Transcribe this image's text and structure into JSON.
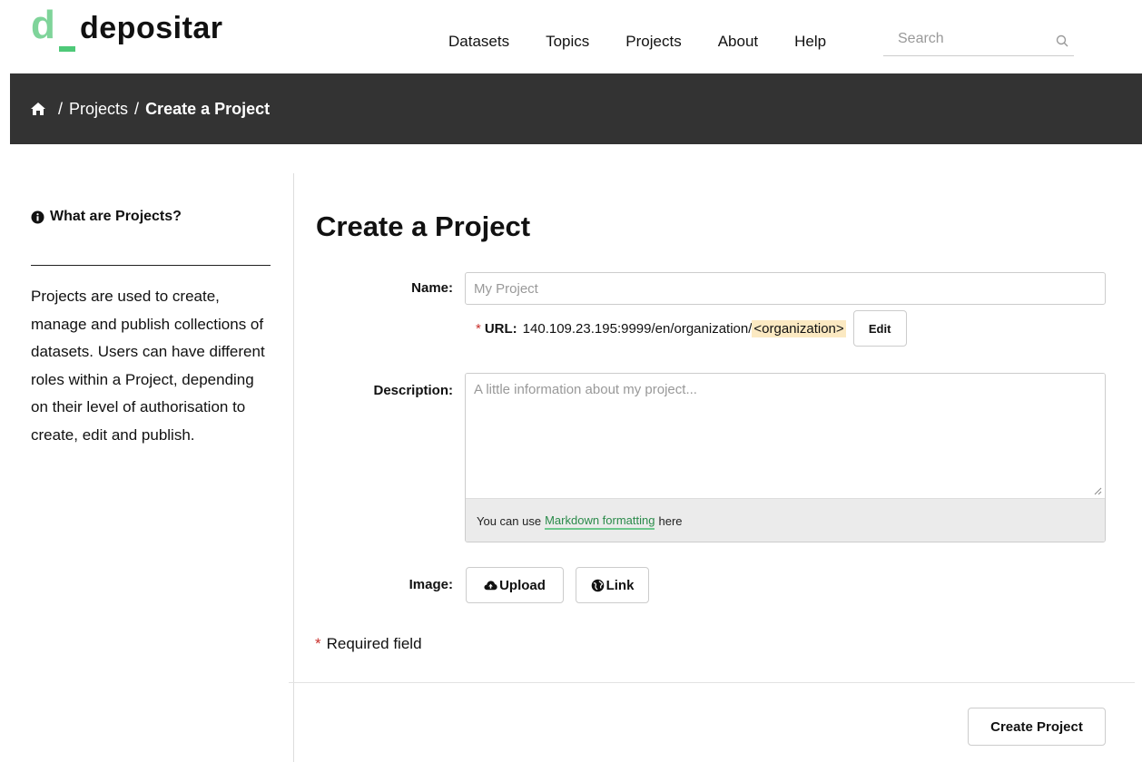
{
  "header": {
    "logo_mark": "d",
    "logo_text": "depositar",
    "nav": [
      "Datasets",
      "Topics",
      "Projects",
      "About",
      "Help"
    ],
    "search_placeholder": "Search"
  },
  "breadcrumb": {
    "separator": "/",
    "items": [
      "Projects",
      "Create a Project"
    ]
  },
  "sidebar": {
    "heading": "What are Projects?",
    "text": "Projects are used to create, manage and publish collections of datasets. Users can have different roles within a Project, depending on their level of authorisation to create, edit and publish."
  },
  "form": {
    "title": "Create a Project",
    "name_label": "Name:",
    "name_placeholder": "My Project",
    "url_star": "*",
    "url_label": "URL:",
    "url_base": "140.109.23.195:9999/en/organization/",
    "url_slug": "<organization>",
    "edit_label": "Edit",
    "description_label": "Description:",
    "description_placeholder": "A little information about my project...",
    "markdown_prefix": "You can use",
    "markdown_link": "Markdown formatting",
    "markdown_suffix": "here",
    "image_label": "Image:",
    "upload_label": "Upload",
    "link_label": "Link",
    "required_star": "*",
    "required_note": "Required field",
    "submit_label": "Create Project"
  },
  "colors": {
    "logo_green": "#7fd49a",
    "breadcrumb_bg": "#333333",
    "required_red": "#c9302c",
    "slug_highlight": "#fbe9c2",
    "link_green": "#2a8a4a"
  }
}
